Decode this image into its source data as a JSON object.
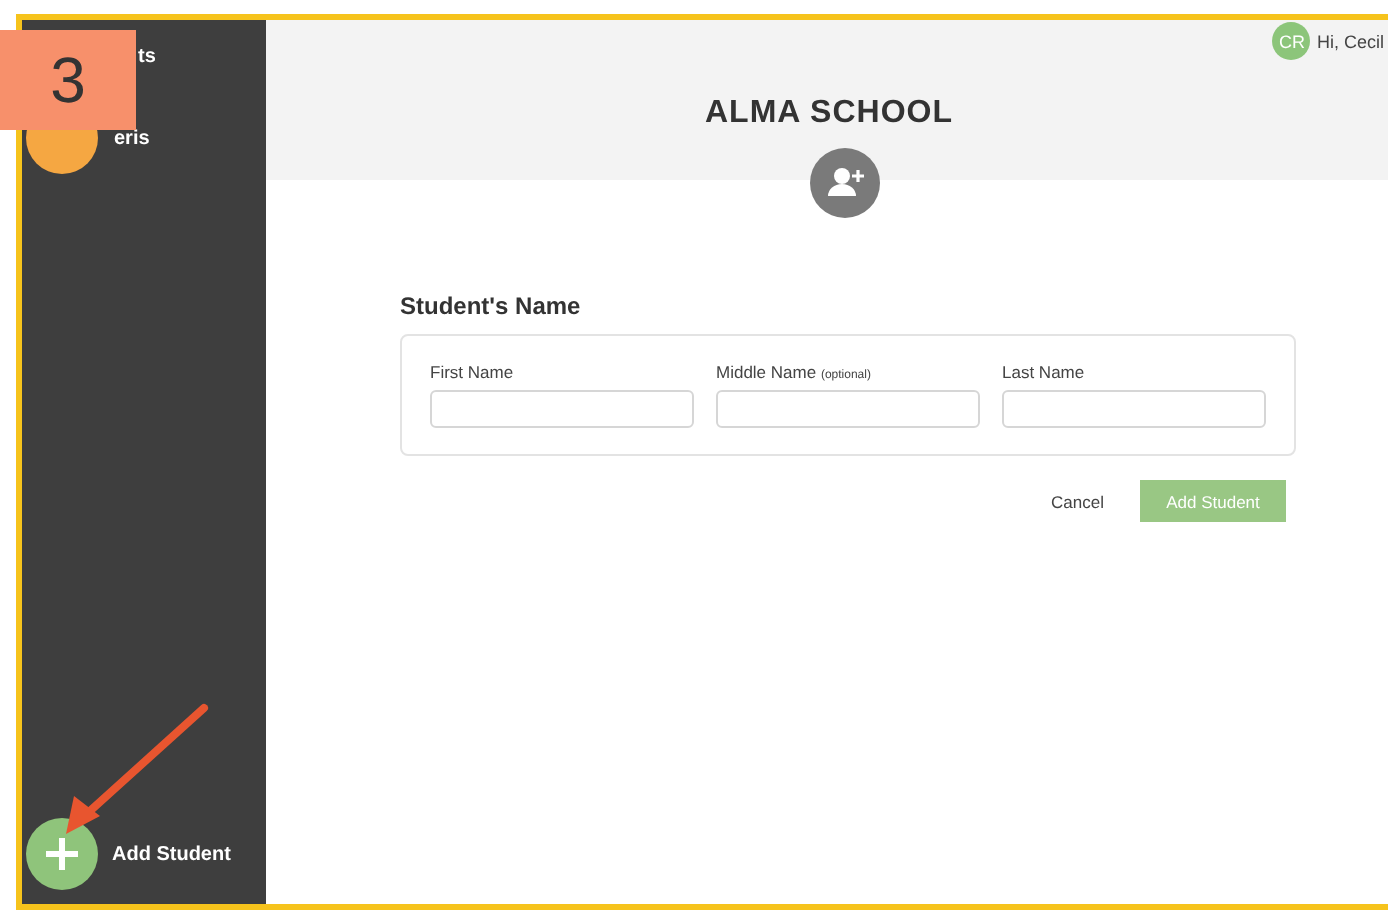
{
  "badge": "3",
  "sidebar": {
    "items": [
      {
        "label": "ts",
        "kind": "text"
      },
      {
        "label": "eris",
        "kind": "avatar"
      }
    ],
    "add_button": {
      "label": "Add Student"
    }
  },
  "header": {
    "title": "ALMA SCHOOL"
  },
  "user": {
    "initials": "CR",
    "greeting": "Hi, Cecil"
  },
  "form": {
    "title": "Student's Name",
    "fields": [
      {
        "label": "First Name"
      },
      {
        "label": "Middle Name",
        "hint": "(optional)"
      },
      {
        "label": "Last Name"
      }
    ],
    "buttons": [
      {
        "label": "Cancel",
        "kind": "link"
      },
      {
        "label": "Add Student",
        "kind": "primary"
      }
    ]
  }
}
